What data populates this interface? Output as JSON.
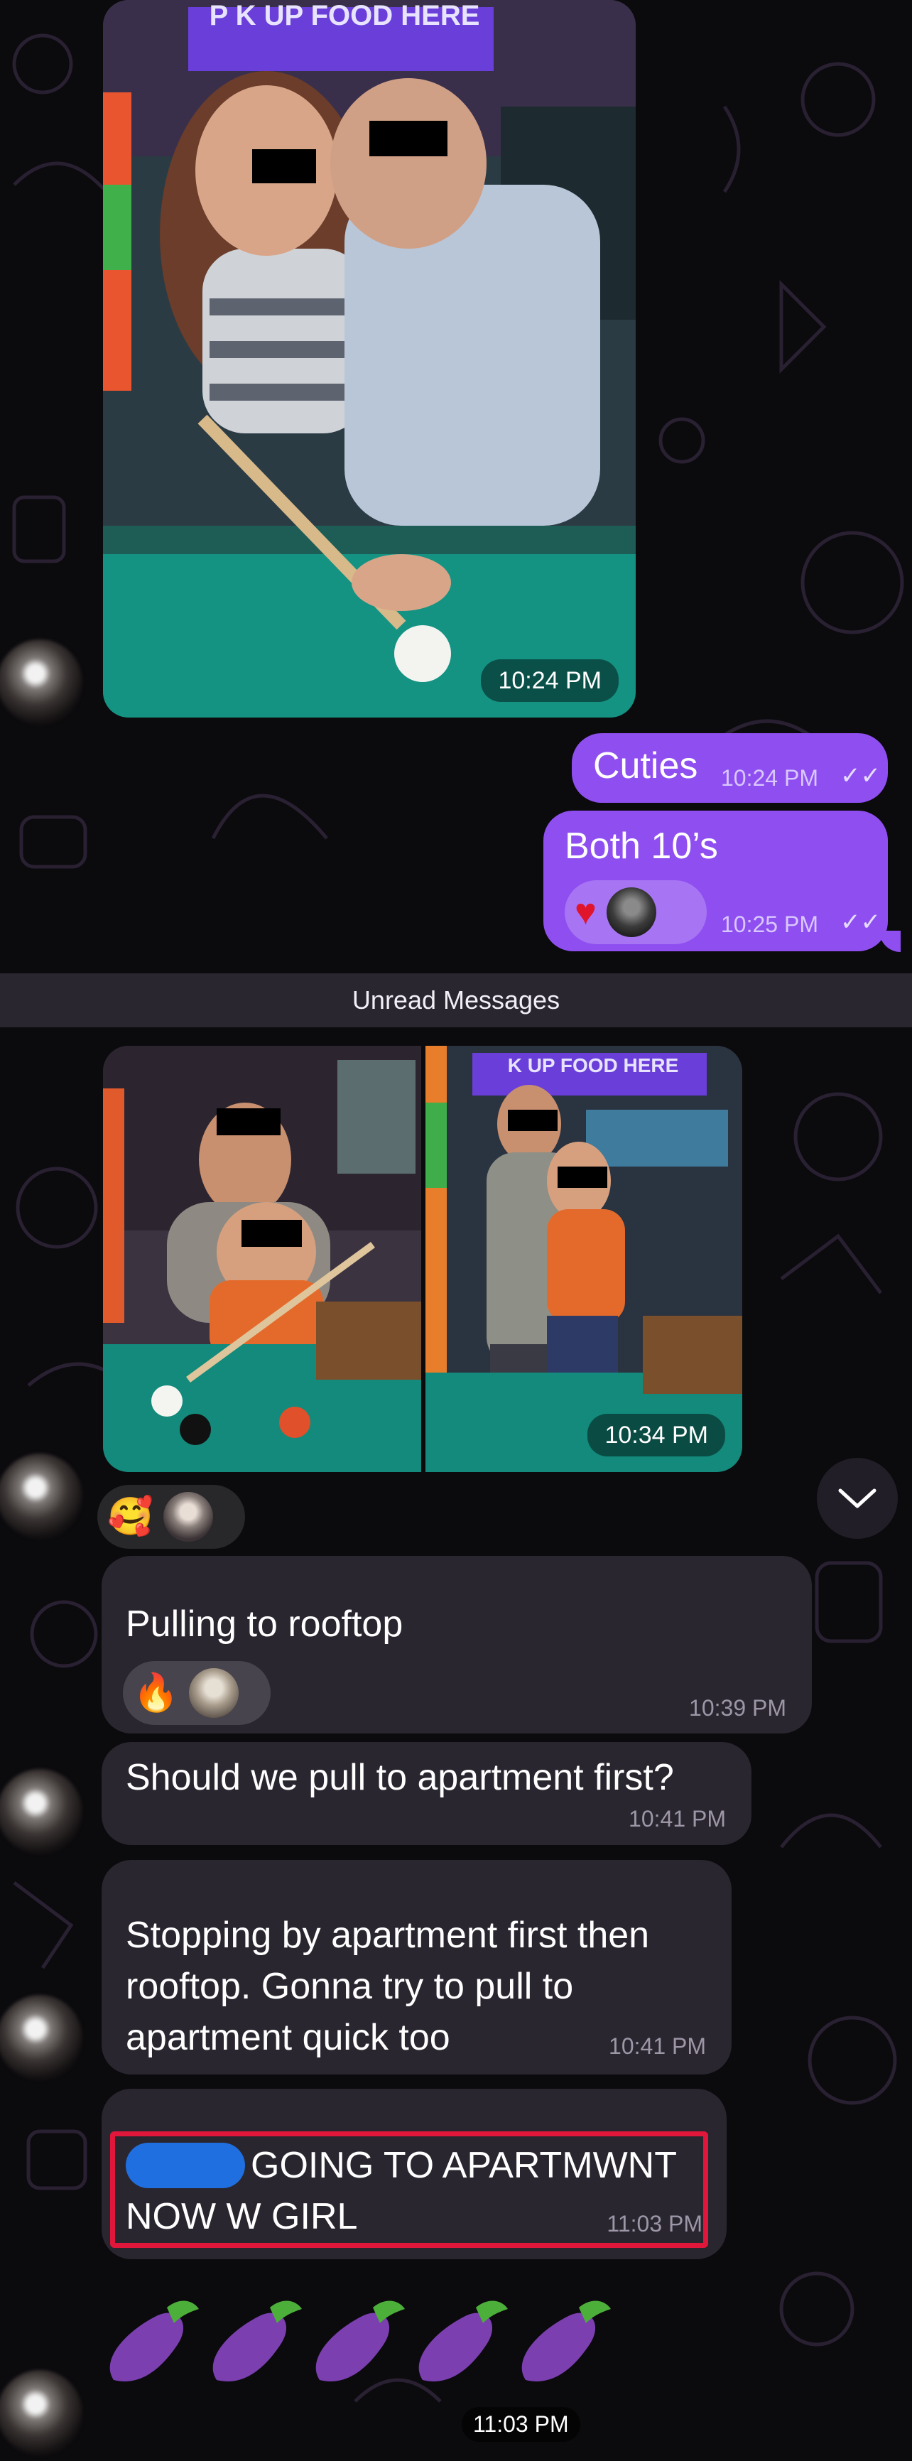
{
  "messages": {
    "photo1_time": "10:24 PM",
    "cuties_text": "Cuties",
    "cuties_time": "10:24 PM",
    "both_text": "Both 10’s",
    "both_time": "10:25 PM",
    "both_reaction": "heart",
    "unread_label": "Unread Messages",
    "photo2_time": "10:34 PM",
    "photo_reaction": "smiling-face-with-hearts",
    "pulling_text": "Pulling to rooftop",
    "pulling_time": "10:39 PM",
    "pulling_reaction": "fire",
    "apartment_q_text": "Should we pull to apartment first?",
    "apartment_q_time": "10:41 PM",
    "stopping_text": "Stopping by apartment first then rooftop. Gonna try to pull to apartment quick too",
    "stopping_time": "10:41 PM",
    "going_text": "GOING TO APARTMWNT NOW W GIRL",
    "going_time": "11:03 PM",
    "eggplant_count": 5,
    "eggplant_time": "11:03 PM"
  },
  "photo_signs": {
    "pickup_sign": "P  K UP FOOD HERE",
    "pickup_sign2": "K UP FOOD HERE"
  },
  "colors": {
    "outgoing_bubble": "#8f4ff0",
    "incoming_bubble": "#2a2630",
    "highlight_box": "#e0163a",
    "background": "#0b0a0d"
  }
}
